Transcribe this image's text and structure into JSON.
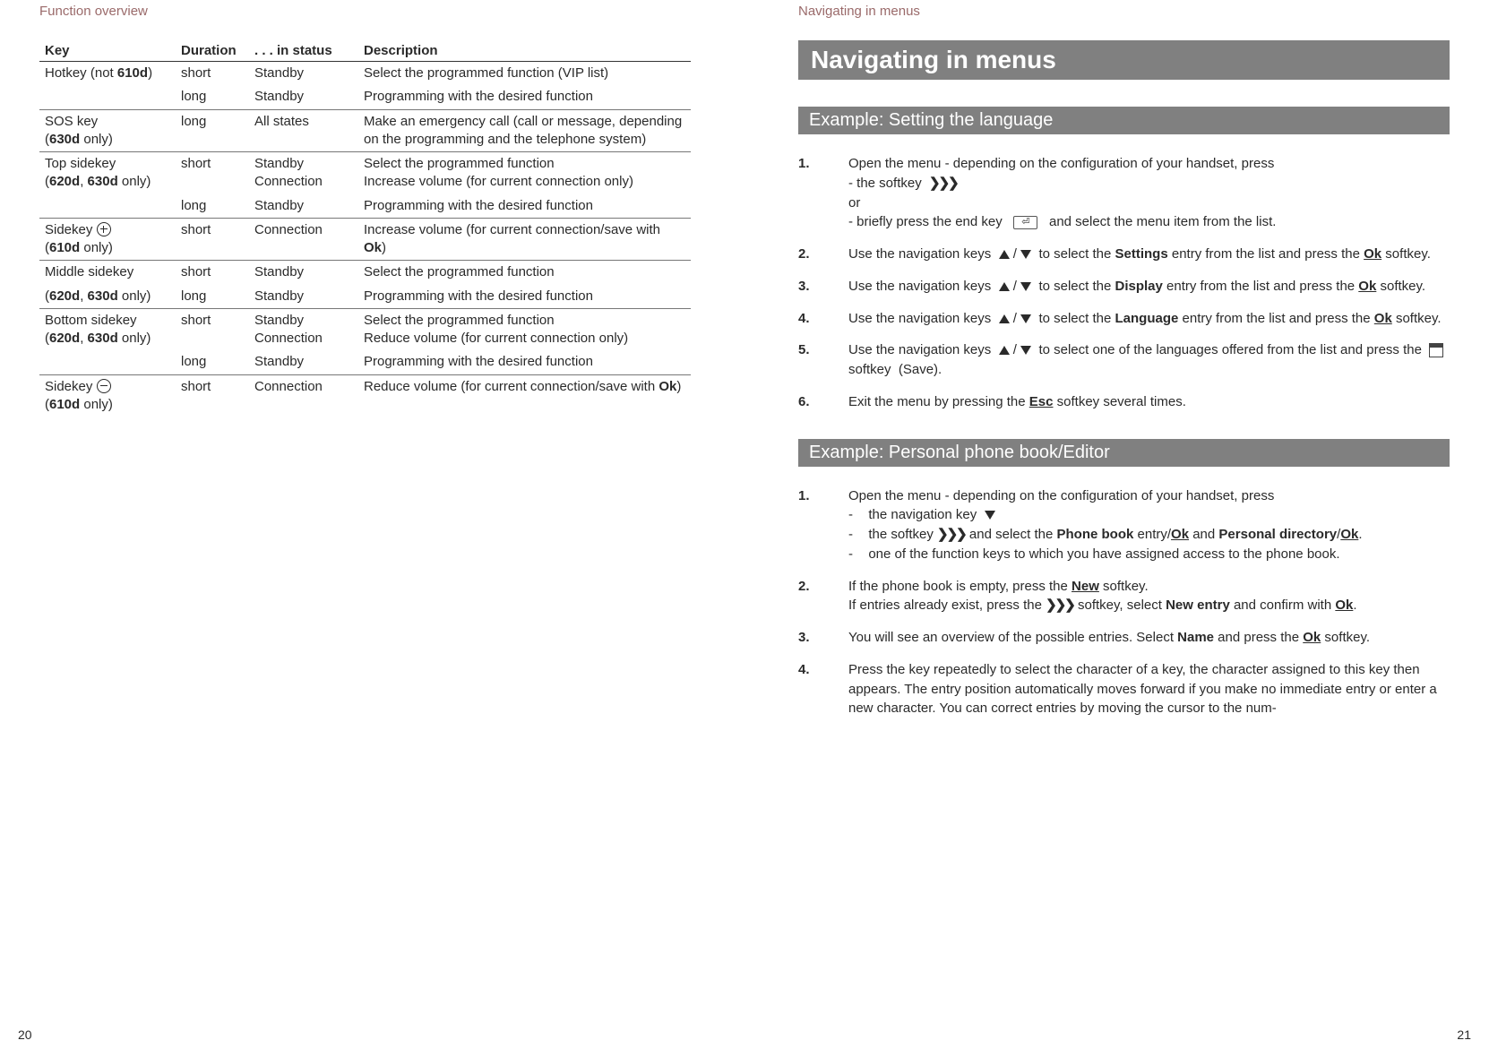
{
  "left": {
    "running_head": "Function overview",
    "table": {
      "headers": {
        "key": "Key",
        "dur": "Duration",
        "status": ". . . in status",
        "desc": "Description"
      },
      "rows": [
        {
          "key_html": "Hotkey (not <b>610d</b>)",
          "dur": "short",
          "status": "Standby",
          "desc": "Select the programmed function (VIP list)",
          "sep_after": false,
          "show_key": true
        },
        {
          "key_html": "",
          "dur": "long",
          "status": "Standby",
          "desc": "Programming with the desired function",
          "sep_after": true,
          "show_key": false
        },
        {
          "key_html": "SOS key<br>(<b>630d</b> only)",
          "dur": "long",
          "status": "All states",
          "desc": "Make an emergency call (call or message, depending on the programming and the telephone system)",
          "sep_after": true,
          "show_key": true
        },
        {
          "key_html": "Top sidekey<br>(<b>620d</b>, <b>630d</b> only)",
          "dur": "short",
          "status": "Standby<br>Connection",
          "desc": "Select the programmed function<br>Increase volume (for current connection only)",
          "sep_after": false,
          "show_key": true
        },
        {
          "key_html": "",
          "dur": "long",
          "status": "Standby",
          "desc": "Programming with the desired function",
          "sep_after": true,
          "show_key": false
        },
        {
          "key_html": "Sidekey <span class='circle-ic plus' data-name='plus-icon' data-interactable='false'></span><br>(<b>610d</b> only)",
          "dur": "short",
          "status": "Connection",
          "desc": "Increase volume (for current connection/save with <b>Ok</b>)",
          "sep_after": true,
          "show_key": true
        },
        {
          "key_html": "Middle sidekey",
          "dur": "short",
          "status": "Standby",
          "desc": "Select the programmed function",
          "sep_after": false,
          "show_key": true
        },
        {
          "key_html": "(<b>620d</b>, <b>630d</b> only)",
          "dur": "long",
          "status": "Standby",
          "desc": "Programming with the desired function",
          "sep_after": true,
          "show_key": true
        },
        {
          "key_html": "Bottom sidekey<br>(<b>620d</b>, <b>630d</b> only)",
          "dur": "short",
          "status": "Standby<br>Connection",
          "desc": "Select the programmed function<br>Reduce volume (for current connection only)",
          "sep_after": false,
          "show_key": true
        },
        {
          "key_html": "",
          "dur": "long",
          "status": "Standby",
          "desc": "Programming with the desired function",
          "sep_after": true,
          "show_key": false
        },
        {
          "key_html": "Sidekey <span class='circle-ic minus' data-name='minus-icon' data-interactable='false'></span><br>(<b>610d</b> only)",
          "dur": "short",
          "status": "Connection",
          "desc": "Reduce volume (for current connection/save with <b>Ok</b>)",
          "sep_after": false,
          "show_key": true
        }
      ]
    },
    "page_num": "20"
  },
  "right": {
    "running_head": "Navigating in menus",
    "h1": "Navigating in menus",
    "h2a": "Example: Setting the language",
    "steps_a": [
      "Open the menu - depending on the configuration of your handset, press<br>- the softkey&nbsp; <span class='chevrons' data-name='menu-softkey-icon' data-interactable='false'>❯❯❯</span><br>or<br>- briefly press the end key &nbsp; <span class='endkey' data-name='end-key-icon' data-interactable='false'>⏎</span> &nbsp; and select the menu item from the list.",
      "Use the navigation keys&nbsp; <span class='tri-up' data-name='nav-up-icon' data-interactable='false'></span> / <span class='tri-down' data-name='nav-down-icon' data-interactable='false'></span> &nbsp;to select the <b>Settings</b> entry from the list and press the <b class='u'>Ok</b> softkey.",
      "Use the navigation keys&nbsp; <span class='tri-up' data-name='nav-up-icon' data-interactable='false'></span> / <span class='tri-down' data-name='nav-down-icon' data-interactable='false'></span> &nbsp;to select the <b>Display</b> entry from the list and press the <b class='u'>Ok</b> softkey.",
      "Use the navigation keys&nbsp; <span class='tri-up' data-name='nav-up-icon' data-interactable='false'></span> / <span class='tri-down' data-name='nav-down-icon' data-interactable='false'></span> &nbsp;to select the <b>Language</b> entry from the list and press the <b class='u'>Ok</b> softkey.",
      "Use the navigation keys&nbsp; <span class='tri-up' data-name='nav-up-icon' data-interactable='false'></span> / <span class='tri-down' data-name='nav-down-icon' data-interactable='false'></span> &nbsp;to select one of the languages offered from the list and press the &nbsp;<span class='save-ic' data-name='save-icon' data-interactable='false'></span>&nbsp; softkey &nbsp;(Save).",
      "Exit the menu by pressing the <b class='u'>Esc</b> softkey several times."
    ],
    "h2b": "Example: Personal phone book/Editor",
    "steps_b": [
      "Open the menu - depending on the configuration of your handset, press<br><span class='sub'><span class='dash'>-</span>&nbsp; the navigation key &nbsp;<span class='tri-down' data-name='nav-down-icon' data-interactable='false'></span></span><br><span class='sub'><span class='dash'>-</span>&nbsp; the softkey <span class='chevrons' data-name='menu-softkey-icon' data-interactable='false'>❯❯❯</span> and select the <b>Phone book</b> entry/<b class='u'>Ok</b> and <b>Personal directory</b>/<b class='u'>Ok</b>.</span><br><span class='sub'><span class='dash'>-</span>&nbsp; one of the function keys to which you have assigned access to the phone book.</span>",
      "If the phone book is empty, press the <b class='u'>New</b> softkey.<br>If entries already exist, press the <span class='chevrons' data-name='menu-softkey-icon' data-interactable='false'>❯❯❯</span> softkey, select <b>New entry</b> and confirm with <b class='u'>Ok</b>.",
      "You will see an overview of the possible entries. Select <b>Name</b> and press the <b class='u'>Ok</b> softkey.",
      "Press the key repeatedly to select the character of a key, the character assigned to this key then appears. The entry position automatically moves forward if you make no immediate entry or enter a new character. You can correct entries by moving the cursor to the num-"
    ],
    "page_num": "21"
  }
}
